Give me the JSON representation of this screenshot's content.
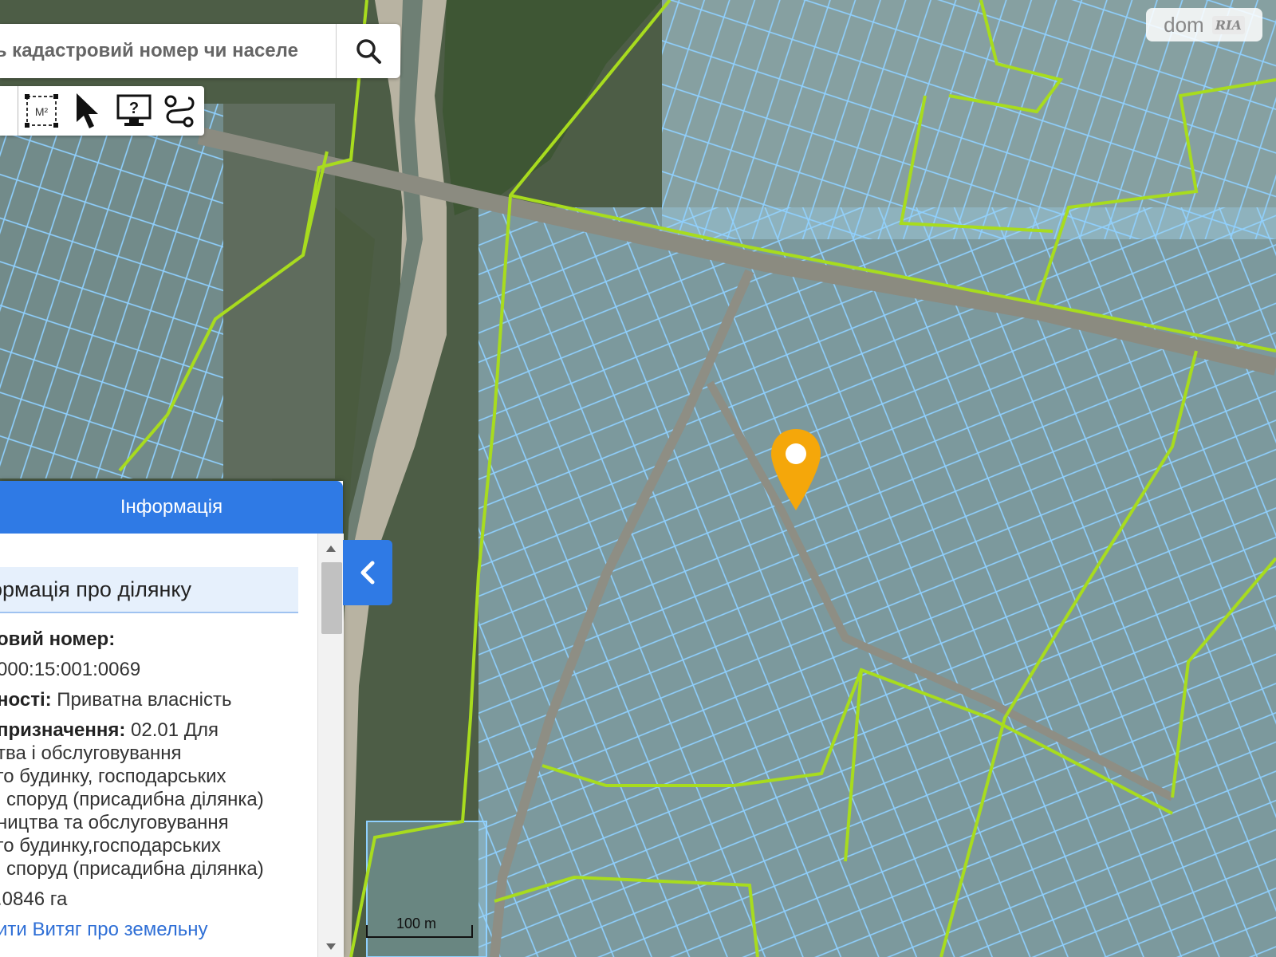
{
  "search": {
    "placeholder": "ть кадастровий номер чи населе"
  },
  "toolbar": {
    "tools": [
      "area-measure",
      "select-pointer",
      "info",
      "route"
    ],
    "area_label": "M²",
    "help_label": "?"
  },
  "logo": {
    "dom": "dom",
    "ria": "RIA"
  },
  "panel": {
    "header": "Інформація",
    "section_title": "ормація про ділянку",
    "fields": [
      {
        "label": "овий номер:",
        "value": ""
      },
      {
        "label": "",
        "value": "000:15:001:0069"
      },
      {
        "label": "ності:",
        "value": " Приватна власність"
      },
      {
        "label": "призначення:",
        "value": " 02.01 Для"
      },
      {
        "label": "",
        "value": "тва і обслуговування"
      },
      {
        "label": "",
        "value": "го будинку, господарських"
      },
      {
        "label": "",
        "value": "і споруд (присадибна ділянка)"
      },
      {
        "label": "",
        "value": "ництва та обслуговування"
      },
      {
        "label": "",
        "value": "го будинку,господарських"
      },
      {
        "label": "",
        "value": "і споруд (присадибна ділянка)"
      },
      {
        "label": "",
        "value": ".0846 га"
      }
    ],
    "link": "ити Витяг про земельну"
  },
  "map": {
    "scale_label": "100 m",
    "boundary_color": "#a8dc1e",
    "parcel_color": "#7ec8f5",
    "marker_color": "#f5a70a",
    "imagery": "satellite"
  }
}
